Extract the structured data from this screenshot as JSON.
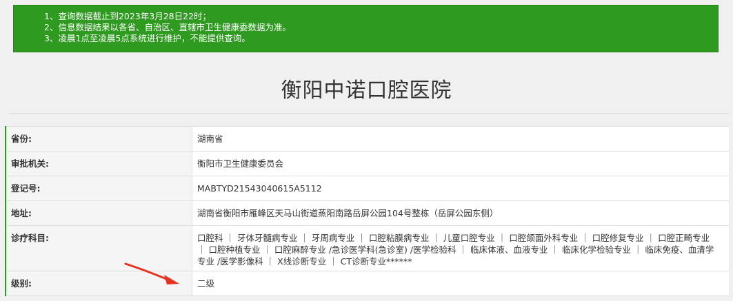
{
  "notice": {
    "lines": [
      "1、查询数据截止到2023年3月28日22时；",
      "2、信息数据结果以各省、自治区、直辖市卫生健康委数据为准。",
      "3、凌晨1点至凌晨5点系统进行维护，不能提供查询。"
    ],
    "background": "#2e9a1f"
  },
  "hospital": {
    "name": "衡阳中诺口腔医院"
  },
  "fields": [
    {
      "label": "省份:",
      "value": "湖南省"
    },
    {
      "label": "审批机关:",
      "value": "衡阳市卫生健康委员会"
    },
    {
      "label": "登记号:",
      "value": "MABTYD21543040615A5112"
    },
    {
      "label": "地址:",
      "value": "湖南省衡阳市雁峰区天马山街道蒸阳南路岳屏公园104号整栋（岳屏公园东侧）"
    },
    {
      "label": "诊疗科目:",
      "value": "口腔科 ｜ 牙体牙髓病专业 ｜ 牙周病专业 ｜ 口腔粘膜病专业 ｜ 儿童口腔专业 ｜ 口腔颌面外科专业 ｜ 口腔修复专业 ｜ 口腔正畸专业 ｜ 口腔种植专业 ｜ 口腔麻醉专业 /急诊医学科(急诊室) /医学检验科 ｜ 临床体液、血液专业 ｜ 临床化学检验专业 ｜ 临床免疫、血清学专业 /医学影像科 ｜ X线诊断专业 ｜ CT诊断专业******"
    },
    {
      "label": "级别:",
      "value": "二级"
    }
  ],
  "colors": {
    "accent": "#2e9a1f",
    "arrow": "#e8321e"
  },
  "icons": {
    "annotation": "red-arrow-icon"
  }
}
